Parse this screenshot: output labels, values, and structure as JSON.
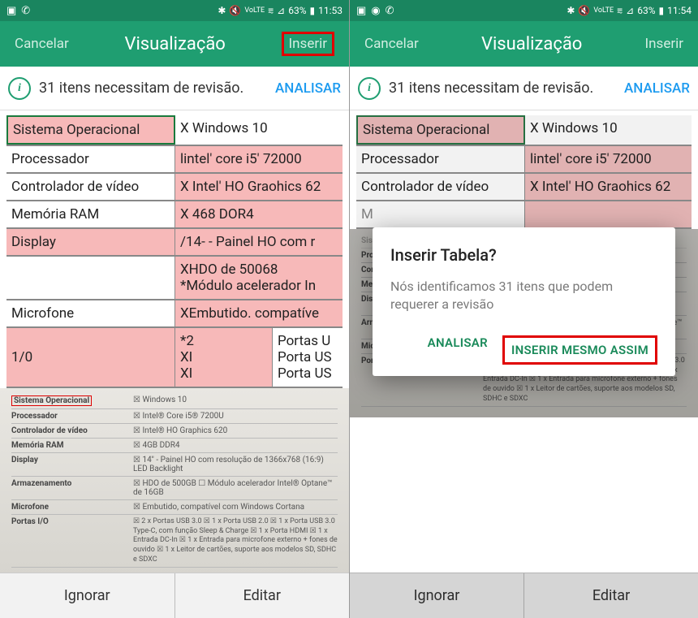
{
  "status": {
    "left_icons": [
      "image-icon",
      "whatsapp-icon"
    ],
    "left_icons_b": [
      "image-icon",
      "messenger-icon",
      "whatsapp-icon"
    ],
    "right_text": "63%",
    "time_a": "11:53",
    "time_b": "11:54",
    "indicators": "✱ ℕ ᵛᵒᴸᵀᴱ ⩳ ⊿"
  },
  "actionbar": {
    "cancel": "Cancelar",
    "title": "Visualização",
    "insert": "Inserir"
  },
  "banner": {
    "text": "31 itens necessitam de revisão.",
    "link": "ANALISAR"
  },
  "table": {
    "rows": [
      {
        "l": "Sistema Operacional",
        "r": "X Windows 10",
        "l_pink": true,
        "r_pink": false,
        "l_green": true
      },
      {
        "l": "Processador",
        "r": "lintel' core i5' 72000",
        "l_pink": false,
        "r_pink": true
      },
      {
        "l": "Controlador de vídeo",
        "r": "X Intel' HO Graohics 62",
        "l_pink": false,
        "r_pink": true
      },
      {
        "l": "Memória RAM",
        "r": "X 468 DOR4",
        "l_pink": false,
        "r_pink": true
      },
      {
        "l": "Display",
        "r": "/14- - Painel HO com r",
        "l_pink": true,
        "r_pink": true
      },
      {
        "l": "",
        "r": "XHDO de 50068\n*Módulo acelerador In",
        "l_pink": false,
        "r_pink": true
      },
      {
        "l": "Microfone",
        "r": "XEmbutido. compatíve",
        "l_pink": false,
        "r_pink": true
      }
    ],
    "io_row": {
      "l": "1/0",
      "mid": "*2\nXI\nXI",
      "right": "Portas U\nPorta US\nPorta US"
    }
  },
  "spec_photo": {
    "rows": [
      {
        "l": "Sistema Operacional",
        "r": "☒ Windows 10",
        "red": true
      },
      {
        "l": "Processador",
        "r": "☒ Intel® Core i5® 7200U"
      },
      {
        "l": "Controlador de vídeo",
        "r": "☒ Intel® HO Graphics 620"
      },
      {
        "l": "Memória RAM",
        "r": "☒ 4GB DDR4"
      },
      {
        "l": "Display",
        "r": "☒ 14\" - Painel HO com resolução de 1366x768 (16:9) LED Backlight"
      },
      {
        "l": "Armazenamento",
        "r": "☒ HDO de 500GB  ☐ Módulo acelerador Intel® Optane™ de 16GB"
      },
      {
        "l": "Microfone",
        "r": "☒ Embutido, compatível com Windows Cortana"
      },
      {
        "l": "Portas I/O",
        "r": "☒ 2 x Portas USB 3.0  ☒ 1 x Porta USB 2.0  ☒ 1 x Porta USB 3.0 Type-C, com função Sleep & Charge  ☒ 1 x Porta HDMI  ☒ 1 x Entrada DC-In  ☒ 1 x Entrada para microfone externo + fones de ouvido  ☒ 1 x Leitor de cartões, suporte aos modelos SD, SDHC e SDXC"
      }
    ]
  },
  "bottom": {
    "ignore": "Ignorar",
    "edit": "Editar"
  },
  "dialog": {
    "title": "Inserir Tabela?",
    "message": "Nós identificamos 31 itens que podem requerer a revisão",
    "analyze": "ANALISAR",
    "insert_anyway": "INSERIR MESMO ASSIM"
  }
}
